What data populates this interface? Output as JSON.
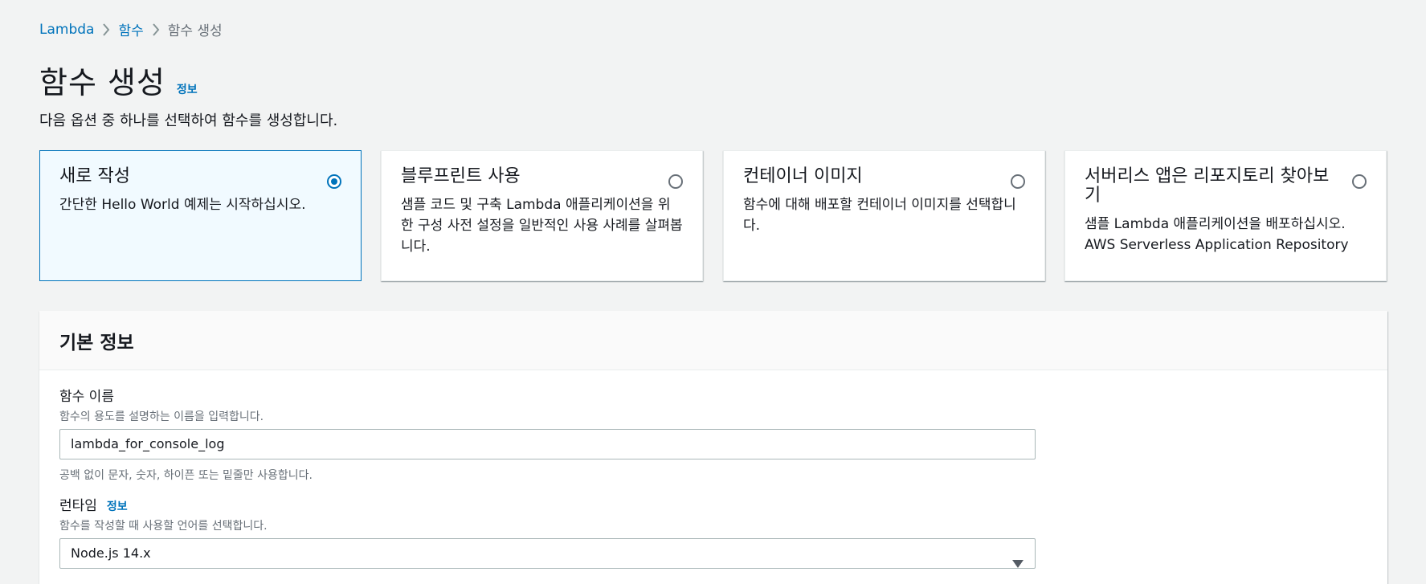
{
  "breadcrumb": {
    "items": [
      {
        "label": "Lambda"
      },
      {
        "label": "함수"
      },
      {
        "label": "함수 생성"
      }
    ]
  },
  "header": {
    "title": "함수 생성",
    "info_link": "정보",
    "description": "다음 옵션 중 하나를 선택하여 함수를 생성합니다."
  },
  "options": [
    {
      "title": "새로 작성",
      "description": "간단한 Hello World 예제는 시작하십시오.",
      "selected": true
    },
    {
      "title": "블루프린트 사용",
      "description": "샘플 코드 및 구축 Lambda 애플리케이션을 위한 구성 사전 설정을 일반적인 사용 사례를 살펴봅니다.",
      "selected": false
    },
    {
      "title": "컨테이너 이미지",
      "description": "함수에 대해 배포할 컨테이너 이미지를 선택합니다.",
      "selected": false
    },
    {
      "title": "서버리스 앱은 리포지토리 찾아보기",
      "description": "샘플 Lambda 애플리케이션을 배포하십시오. AWS Serverless Application Repository",
      "selected": false
    }
  ],
  "basic_info": {
    "title": "기본 정보",
    "function_name": {
      "label": "함수 이름",
      "description": "함수의 용도를 설명하는 이름을 입력합니다.",
      "value": "lambda_for_console_log",
      "constraint": "공백 없이 문자, 숫자, 하이픈 또는 밑줄만 사용합니다."
    },
    "runtime": {
      "label": "런타임",
      "info_link": "정보",
      "description": "함수를 작성할 때 사용할 언어를 선택합니다.",
      "value": "Node.js 14.x"
    }
  },
  "colors": {
    "link": "#0073bb",
    "selected_bg": "#f1faff",
    "background": "#f2f3f3"
  }
}
